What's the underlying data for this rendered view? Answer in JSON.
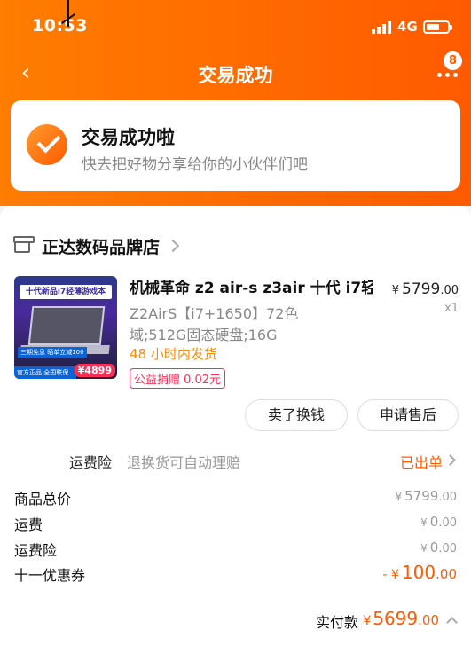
{
  "status_bar": {
    "time": "10:53",
    "network": "4G",
    "signal_icon": "signal-icon",
    "battery_icon": "battery-icon"
  },
  "nav": {
    "title": "交易成功",
    "badge_count": "8",
    "back_icon": "back-arrow-icon",
    "more_icon": "more-dots-icon"
  },
  "success": {
    "title": "交易成功啦",
    "subtitle": "快去把好物分享给你的小伙伴们吧",
    "icon": "check-circle-icon"
  },
  "shop": {
    "name": "正达数码品牌店",
    "icon": "shop-icon"
  },
  "item": {
    "title": "机械革命 z2 air-s z3air 十代 i7轻",
    "price_symbol": "¥",
    "price_int": "5799",
    "price_dec": ".00",
    "quantity": "x1",
    "spec": "Z2AirS【i7+1650】72色域;512G固态硬盘;16G",
    "shipping": "48 小时内发货",
    "charity": "公益捐赠 0.02元",
    "thumbnail": {
      "banner": "十代新品i7轻薄游戏本",
      "tag": "三期免息 晒单立减100",
      "official": "官方正品 全国联保",
      "price": "¥4899"
    }
  },
  "actions": {
    "sell_label": "卖了换钱",
    "after_sale_label": "申请售后"
  },
  "insurance": {
    "label": "运费险",
    "desc": "退换货可自动理赔",
    "status": "已出单"
  },
  "summary": [
    {
      "label": "商品总价",
      "symbol": "¥",
      "int": "5799",
      "dec": ".00"
    },
    {
      "label": "运费",
      "symbol": "¥",
      "int": "0",
      "dec": ".00"
    },
    {
      "label": "运费险",
      "symbol": "¥",
      "int": "0",
      "dec": ".00"
    },
    {
      "label": "十一优惠券",
      "symbol": "- ¥",
      "int": "100",
      "dec": ".00"
    }
  ],
  "paid": {
    "label": "实付款",
    "symbol": "¥",
    "int": "5699",
    "dec": ".00"
  },
  "colors": {
    "accent": "#ff5a00",
    "gradient_start": "#ff7d00",
    "charity": "#ff2d55",
    "shipping": "#ff8a00"
  }
}
